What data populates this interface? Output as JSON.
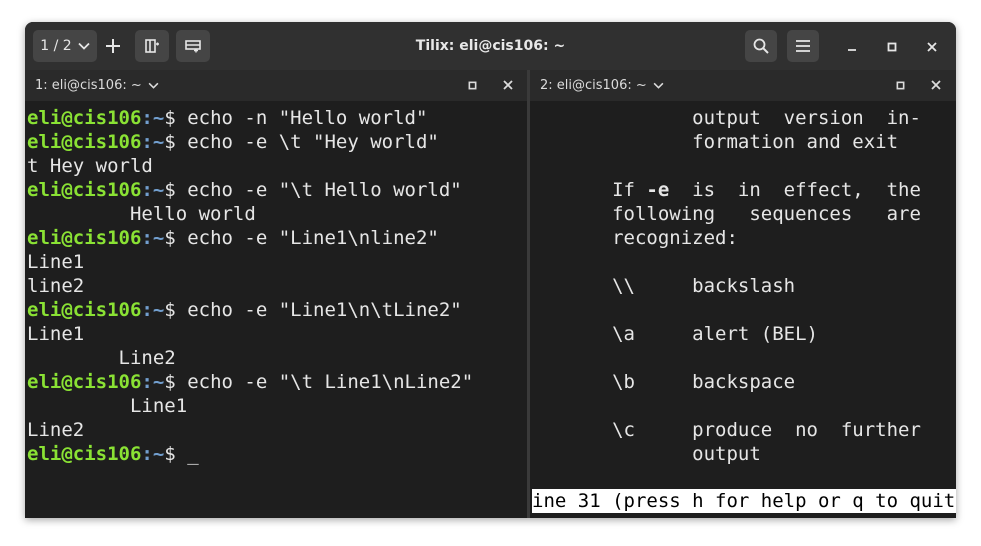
{
  "window": {
    "title": "Tilix: eli@cis106: ~",
    "session_counter": "1 / 2"
  },
  "icons": {
    "chevron": "chevron-down-icon",
    "add": "plus-icon",
    "add_right": "add-terminal-right-icon",
    "add_down": "add-terminal-down-icon",
    "search": "search-icon",
    "menu": "hamburger-menu-icon",
    "minimize": "minimize-icon",
    "maximize": "maximize-icon",
    "close": "close-icon"
  },
  "colors": {
    "user_host": "#8ae234",
    "path_prompt": "#729fcf",
    "text": "#e6e6e6",
    "background": "#1e1e1e",
    "headerbar": "#303030"
  },
  "left_pane": {
    "title": "1: eli@cis106: ~",
    "lines": [
      {
        "user": "eli@cis106",
        "sep": ":",
        "path": "~",
        "prompt": "$",
        "cmd": " echo -n \"Hello world\""
      },
      {
        "user": "eli@cis106",
        "sep": ":",
        "path": "~",
        "prompt": "$",
        "cmd": " echo -e \\t \"Hey world\""
      },
      {
        "text": "t Hey world"
      },
      {
        "user": "eli@cis106",
        "sep": ":",
        "path": "~",
        "prompt": "$",
        "cmd": " echo -e \"\\t Hello world\""
      },
      {
        "text": "         Hello world"
      },
      {
        "user": "eli@cis106",
        "sep": ":",
        "path": "~",
        "prompt": "$",
        "cmd": " echo -e \"Line1\\nline2\""
      },
      {
        "text": "Line1"
      },
      {
        "text": "line2"
      },
      {
        "user": "eli@cis106",
        "sep": ":",
        "path": "~",
        "prompt": "$",
        "cmd": " echo -e \"Line1\\n\\tLine2\""
      },
      {
        "text": "Line1"
      },
      {
        "text": "        Line2"
      },
      {
        "user": "eli@cis106",
        "sep": ":",
        "path": "~",
        "prompt": "$",
        "cmd": " echo -e \"\\t Line1\\nLine2\""
      },
      {
        "text": "         Line1"
      },
      {
        "text": "Line2"
      },
      {
        "user": "eli@cis106",
        "sep": ":",
        "path": "~",
        "prompt": "$",
        "cmd": " _"
      }
    ]
  },
  "right_pane": {
    "title": "2: eli@cis106: ~",
    "lines": [
      {
        "text": "              output  version  in-"
      },
      {
        "text": "              formation and exit"
      },
      {
        "text": ""
      },
      {
        "pre": "       If ",
        "bold": "-e",
        "post": "  is  in  effect,  the"
      },
      {
        "text": "       following   sequences   are"
      },
      {
        "text": "       recognized:"
      },
      {
        "text": ""
      },
      {
        "text": "       \\\\     backslash"
      },
      {
        "text": ""
      },
      {
        "text": "       \\a     alert (BEL)"
      },
      {
        "text": ""
      },
      {
        "text": "       \\b     backspace"
      },
      {
        "text": ""
      },
      {
        "text": "       \\c     produce  no  further"
      },
      {
        "text": "              output"
      }
    ],
    "status": "ine 31 (press h for help or q to quit)"
  }
}
